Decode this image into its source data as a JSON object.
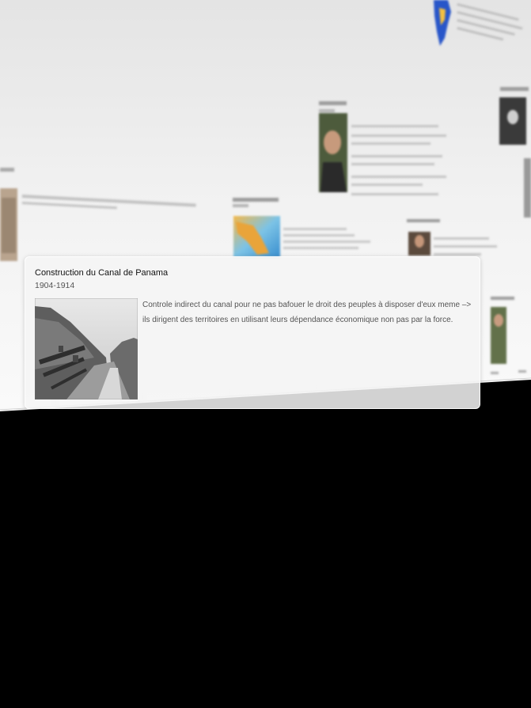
{
  "popup": {
    "title": "Construction du Canal de Panama",
    "dates": "1904-1914",
    "description": "Controle indirect du canal pour ne pas bafouer le droit des peuples à disposer d'eux meme –> ils dirigent des territoires en utilisant leurs dépendance économique non pas par la force.",
    "photo_icon": "canal-photo"
  },
  "colors": {
    "background": "#000000",
    "wall": "#efefef",
    "card": "#f4f4f4"
  }
}
